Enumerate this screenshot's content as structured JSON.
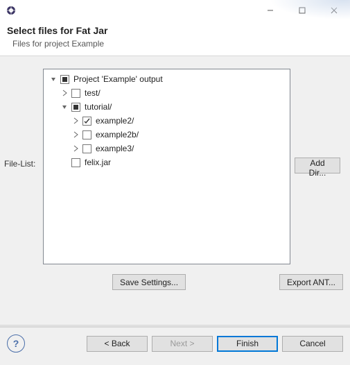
{
  "header": {
    "title": "Select files for Fat Jar",
    "subtitle": "Files for project Example"
  },
  "fileListLabel": "File-List:",
  "tree": {
    "root": {
      "label": "Project 'Example' output"
    },
    "test": {
      "label": "test/"
    },
    "tutorial": {
      "label": "tutorial/"
    },
    "example2": {
      "label": "example2/"
    },
    "example2b": {
      "label": "example2b/"
    },
    "example3": {
      "label": "example3/"
    },
    "felix": {
      "label": "felix.jar"
    }
  },
  "buttons": {
    "addDir": "Add Dir...",
    "saveSettings": "Save Settings...",
    "exportAnt": "Export ANT...",
    "back": "< Back",
    "next": "Next >",
    "finish": "Finish",
    "cancel": "Cancel"
  }
}
